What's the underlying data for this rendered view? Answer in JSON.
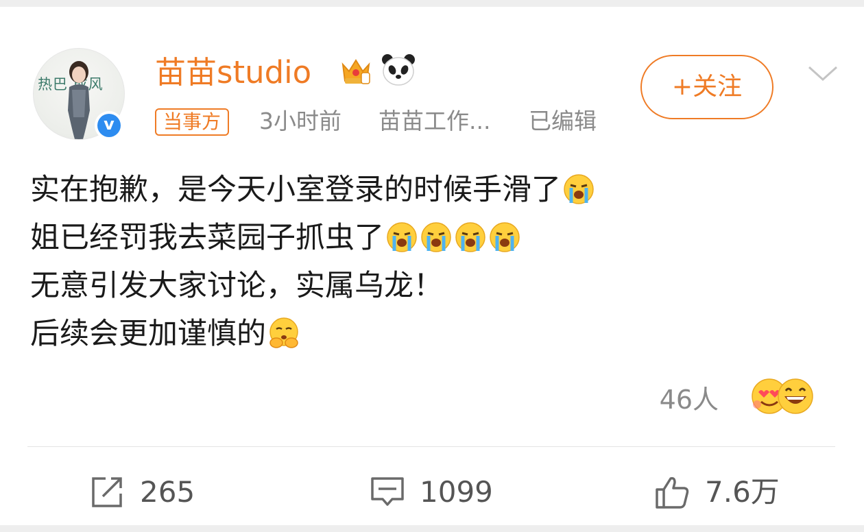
{
  "post": {
    "author": {
      "name": "苗苗studio",
      "avatar_text": "热巴 成风",
      "verified": true,
      "badges": [
        "vip-crown-badge",
        "panda-badge"
      ]
    },
    "meta": {
      "tag": "当事方",
      "time": "3小时前",
      "source": "苗苗工作...",
      "edited": "已编辑"
    },
    "follow_label": "+关注",
    "content": [
      {
        "text": "实在抱歉，是今天小室登录的时候手滑了",
        "emojis": 1
      },
      {
        "text": "姐已经罚我去菜园子抓虫了",
        "emojis": 4
      },
      {
        "text": "无意引发大家讨论，实属乌龙！",
        "emojis": 0
      },
      {
        "text": "后续会更加谨慎的",
        "emojis": 1
      }
    ],
    "reactions": {
      "count": "46人",
      "icons": [
        "heart-face-emoji",
        "laughing-emoji"
      ]
    },
    "actions": {
      "repost": "265",
      "comment": "1099",
      "like": "7.6万"
    }
  },
  "colors": {
    "accent": "#ef7b25",
    "muted": "#8a8a8a",
    "verified": "#2d8cf0"
  }
}
